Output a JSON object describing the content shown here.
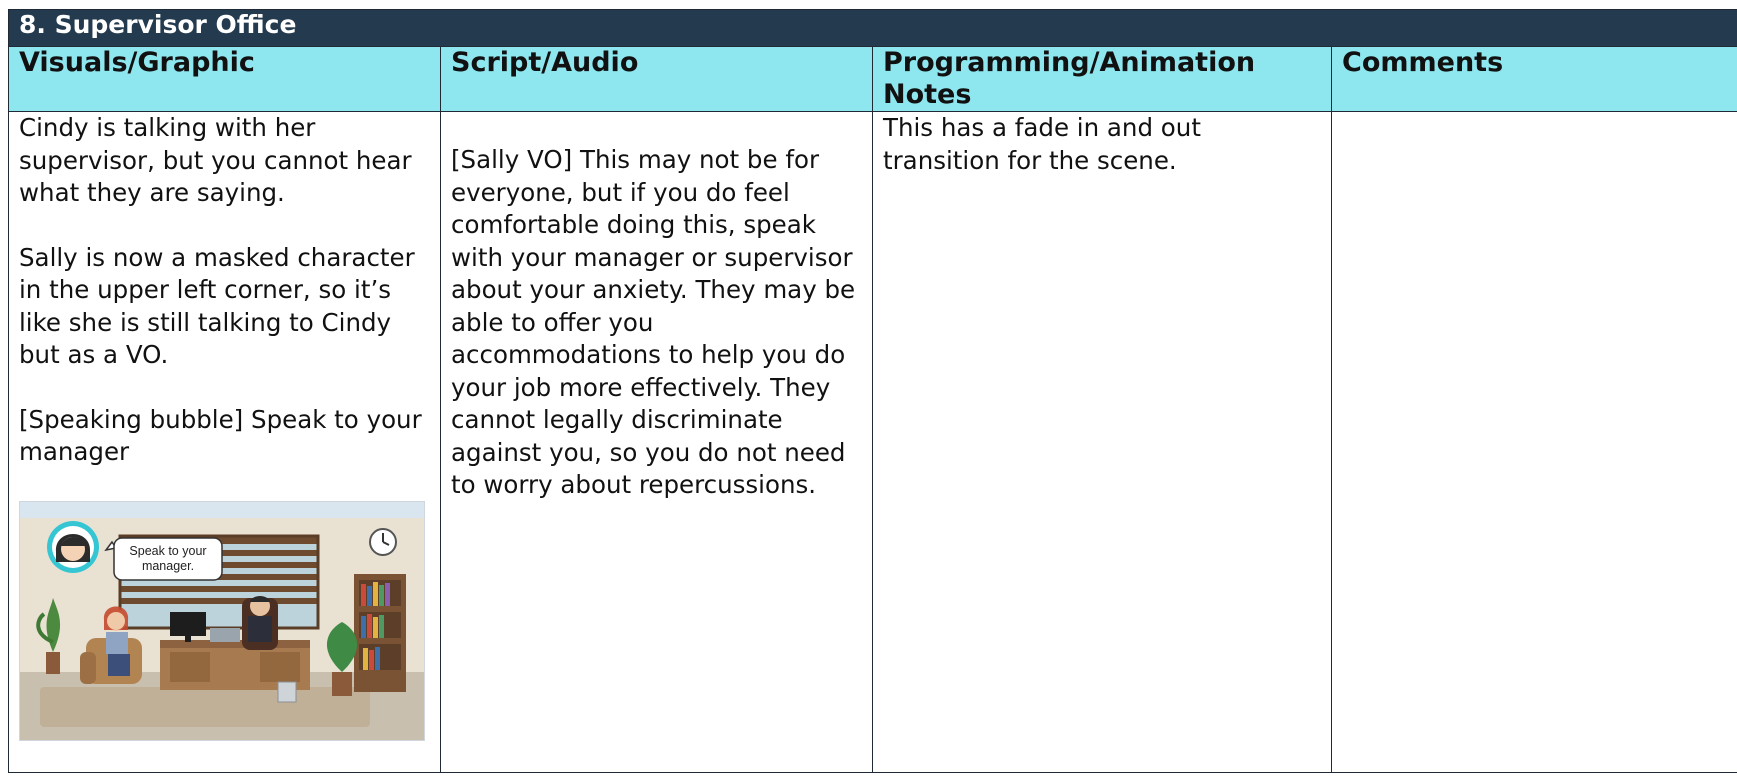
{
  "section_title": "8. Supervisor Office",
  "headers": {
    "visuals": "Visuals/Graphic",
    "script": "Script/Audio",
    "programming": "Programming/Animation Notes",
    "comments": "Comments"
  },
  "visuals": {
    "p1": "Cindy is talking with her supervisor, but you cannot hear what they are saying.",
    "p2": "Sally is now a masked character in the upper left corner, so it’s like she is still talking to Cindy but as a VO.",
    "p3": "[Speaking bubble] Speak to your manager",
    "bubble_line1": "Speak to your",
    "bubble_line2": "manager."
  },
  "script": "[Sally VO] This may not be for everyone, but if you do feel comfortable doing this, speak with your manager or supervisor about your anxiety. They may be able to offer you accommodations to help you do your job more effectively. They cannot legally discriminate against you, so you do not need to worry about repercussions.",
  "programming": "This has a fade in and out transition for the scene.",
  "comments": ""
}
